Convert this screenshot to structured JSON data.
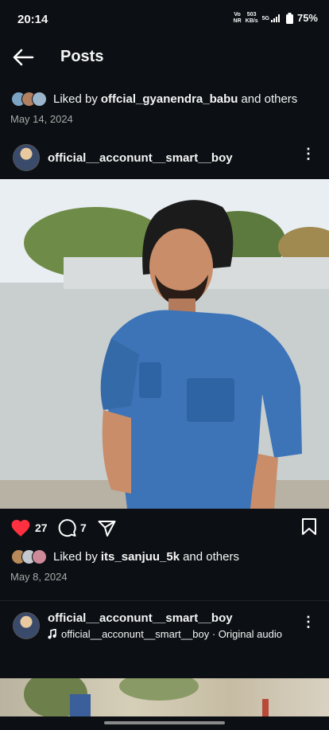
{
  "status_bar": {
    "time": "20:14",
    "volte_top": "Vo",
    "volte_bottom": "NR",
    "speed_value": "503",
    "speed_unit": "KB/s",
    "network": "5G",
    "battery": "75%"
  },
  "header": {
    "title": "Posts"
  },
  "post1": {
    "liked_prefix": "Liked by ",
    "liked_user": "offcial_gyanendra_babu",
    "liked_suffix": " and others",
    "date": "May 14, 2024",
    "username": "official__acconunt__smart__boy"
  },
  "post2": {
    "likes": "27",
    "comments": "7",
    "liked_prefix": "Liked by ",
    "liked_user": "its_sanjuu_5k",
    "liked_suffix": " and others",
    "date": "May 8, 2024"
  },
  "post3": {
    "username": "official__acconunt__smart__boy",
    "audio": "official__acconunt__smart__boy · Original audio"
  },
  "colors": {
    "background": "#0c1014",
    "like_red": "#ff3040",
    "secondary_text": "#a8a8a8"
  }
}
